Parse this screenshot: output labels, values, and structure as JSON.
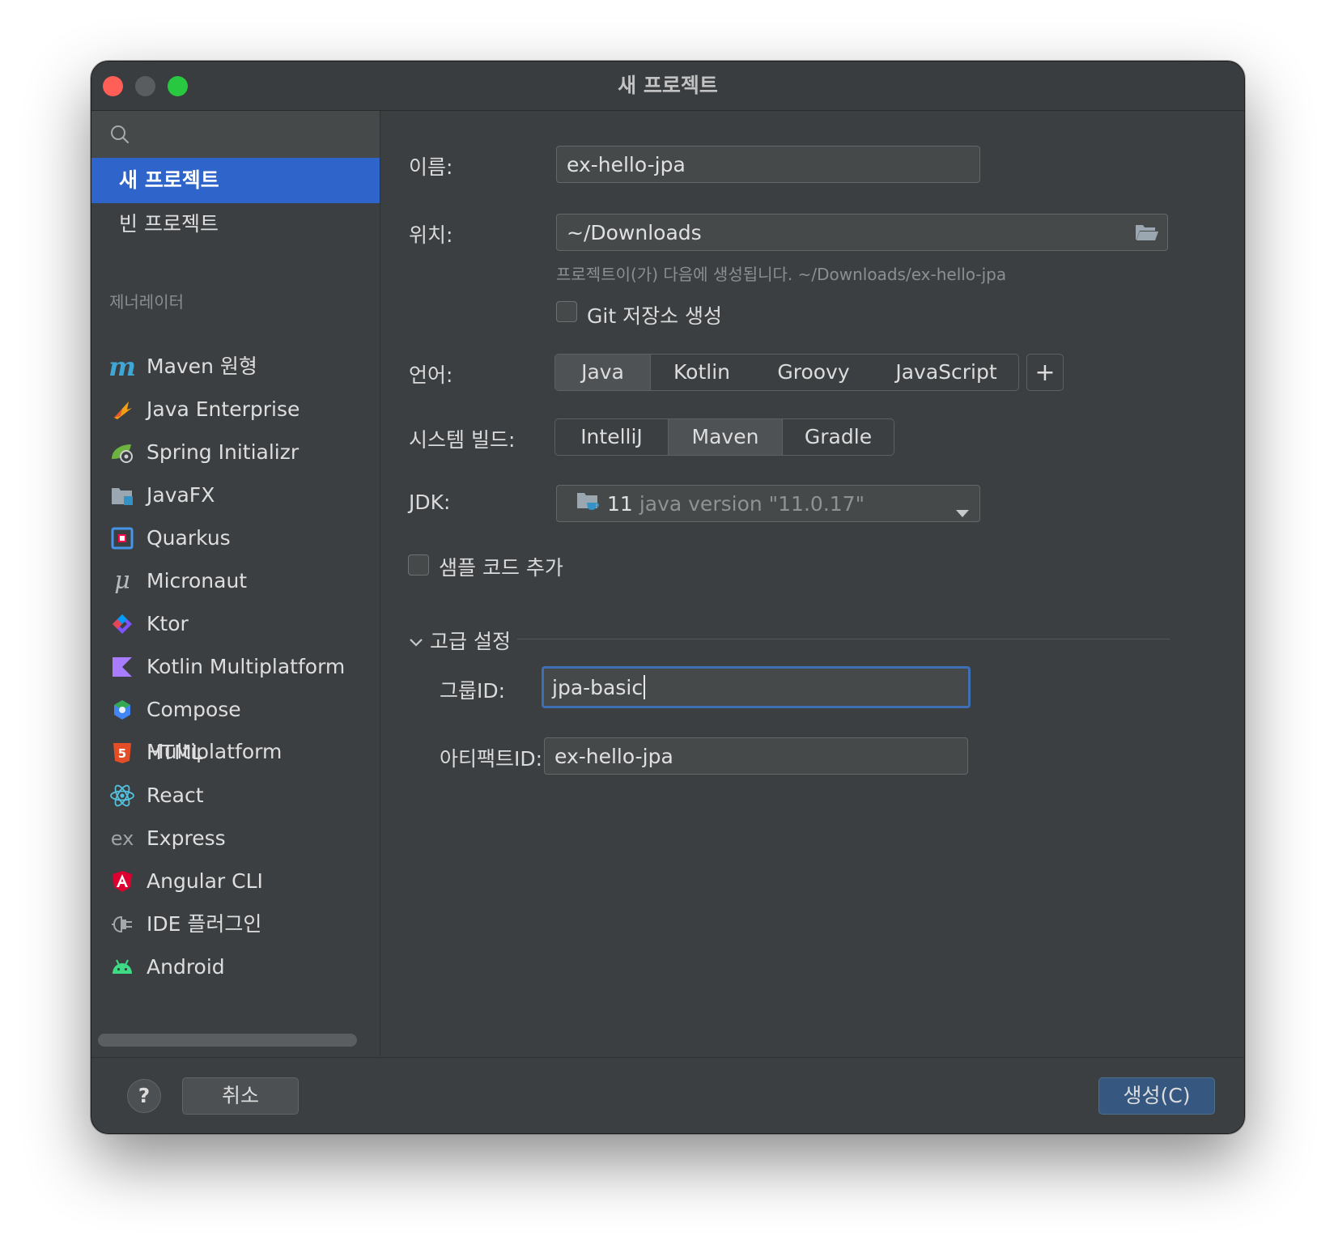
{
  "window": {
    "title": "새 프로젝트"
  },
  "sidebar": {
    "items": [
      {
        "label": "새 프로젝트"
      },
      {
        "label": "빈 프로젝트"
      }
    ],
    "section_label": "제너레이터",
    "generators": [
      {
        "label": "Maven 원형",
        "icon": "maven-icon"
      },
      {
        "label": "Java Enterprise",
        "icon": "java-enterprise-icon"
      },
      {
        "label": "Spring Initializr",
        "icon": "spring-icon"
      },
      {
        "label": "JavaFX",
        "icon": "javafx-icon"
      },
      {
        "label": "Quarkus",
        "icon": "quarkus-icon"
      },
      {
        "label": "Micronaut",
        "icon": "micronaut-icon"
      },
      {
        "label": "Ktor",
        "icon": "ktor-icon"
      },
      {
        "label": "Kotlin Multiplatform",
        "icon": "kotlin-icon"
      },
      {
        "label": "Compose Multiplatform",
        "icon": "compose-icon"
      },
      {
        "label": "HTML",
        "icon": "html5-icon"
      },
      {
        "label": "React",
        "icon": "react-icon"
      },
      {
        "label": "Express",
        "icon": "express-icon"
      },
      {
        "label": "Angular CLI",
        "icon": "angular-icon"
      },
      {
        "label": "IDE 플러그인",
        "icon": "plugin-icon"
      },
      {
        "label": "Android",
        "icon": "android-icon"
      }
    ]
  },
  "form": {
    "name_label": "이름:",
    "name_value": "ex-hello-jpa",
    "location_label": "위치:",
    "location_value": "~/Downloads",
    "location_hint": "프로젝트이(가) 다음에 생성됩니다. ~/Downloads/ex-hello-jpa",
    "git_label": "Git 저장소 생성",
    "language_label": "언어:",
    "languages": [
      "Java",
      "Kotlin",
      "Groovy",
      "JavaScript"
    ],
    "language_selected": "Java",
    "add_language": "+",
    "build_label": "시스템 빌드:",
    "builds": [
      "IntelliJ",
      "Maven",
      "Gradle"
    ],
    "build_selected": "Maven",
    "jdk_label": "JDK:",
    "jdk_number": "11",
    "jdk_version": "java version \"11.0.17\"",
    "sample_label": "샘플 코드 추가",
    "advanced_label": "고급 설정",
    "group_label": "그룹ID:",
    "group_value": "jpa-basic",
    "artifact_label": "아티팩트ID:",
    "artifact_value": "ex-hello-jpa"
  },
  "footer": {
    "help": "?",
    "cancel": "취소",
    "create": "생성(C)"
  },
  "colors": {
    "selected": "#2f65ca",
    "window_bg": "#3c3f41",
    "create_button": "#365880"
  }
}
